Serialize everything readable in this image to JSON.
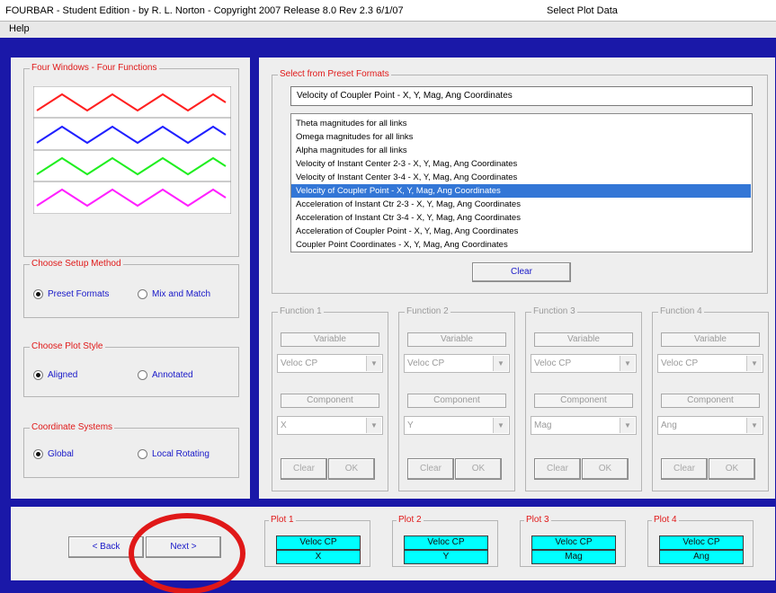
{
  "window": {
    "title": "FOURBAR - Student Edition - by R. L. Norton - Copyright 2007  Release 8.0  Rev 2.3  6/1/07",
    "screen_title": "Select Plot Data"
  },
  "menu": {
    "help": "Help"
  },
  "four_windows": {
    "caption": "Four Windows - Four Functions",
    "colors": [
      "#ff2020",
      "#2020ff",
      "#20ee20",
      "#ff20ff"
    ]
  },
  "setup_method": {
    "caption": "Choose Setup Method",
    "options": [
      "Preset Formats",
      "Mix and Match"
    ],
    "selected": 0
  },
  "plot_style": {
    "caption": "Choose Plot Style",
    "options": [
      "Aligned",
      "Annotated"
    ],
    "selected": 0
  },
  "coordinate_system": {
    "caption": "Coordinate Systems",
    "options": [
      "Global",
      "Local Rotating"
    ],
    "selected": 0
  },
  "preset": {
    "caption": "Select from Preset Formats",
    "current": "Velocity of Coupler Point  -  X, Y, Mag, Ang Coordinates",
    "items": [
      "Theta magnitudes for all links",
      "Omega magnitudes for all links",
      "Alpha magnitudes for all links",
      "Velocity of Instant Center 2-3  -  X, Y, Mag, Ang Coordinates",
      "Velocity of Instant Center 3-4  -  X, Y, Mag, Ang Coordinates",
      "Velocity of Coupler Point  -  X, Y, Mag, Ang Coordinates",
      "Acceleration of Instant Ctr 2-3  -  X, Y, Mag, Ang Coordinates",
      "Acceleration of Instant Ctr 3-4  -  X, Y, Mag, Ang Coordinates",
      "Acceleration of Coupler Point  -  X, Y, Mag, Ang Coordinates",
      "Coupler Point Coordinates  -  X, Y, Mag, Ang Coordinates"
    ],
    "selected_index": 5,
    "clear_label": "Clear"
  },
  "functions": [
    {
      "caption": "Function 1",
      "variable_label": "Variable",
      "variable": "Veloc CP",
      "component_label": "Component",
      "component": "X",
      "clear": "Clear",
      "ok": "OK"
    },
    {
      "caption": "Function 2",
      "variable_label": "Variable",
      "variable": "Veloc CP",
      "component_label": "Component",
      "component": "Y",
      "clear": "Clear",
      "ok": "OK"
    },
    {
      "caption": "Function 3",
      "variable_label": "Variable",
      "variable": "Veloc CP",
      "component_label": "Component",
      "component": "Mag",
      "clear": "Clear",
      "ok": "OK"
    },
    {
      "caption": "Function 4",
      "variable_label": "Variable",
      "variable": "Veloc CP",
      "component_label": "Component",
      "component": "Ang",
      "clear": "Clear",
      "ok": "OK"
    }
  ],
  "nav": {
    "back": "< Back",
    "next": "Next >"
  },
  "plots": [
    {
      "caption": "Plot 1",
      "variable": "Veloc CP",
      "component": "X"
    },
    {
      "caption": "Plot 2",
      "variable": "Veloc CP",
      "component": "Y"
    },
    {
      "caption": "Plot 3",
      "variable": "Veloc CP",
      "component": "Mag"
    },
    {
      "caption": "Plot 4",
      "variable": "Veloc CP",
      "component": "Ang"
    }
  ],
  "highlight_color": "#e01818"
}
